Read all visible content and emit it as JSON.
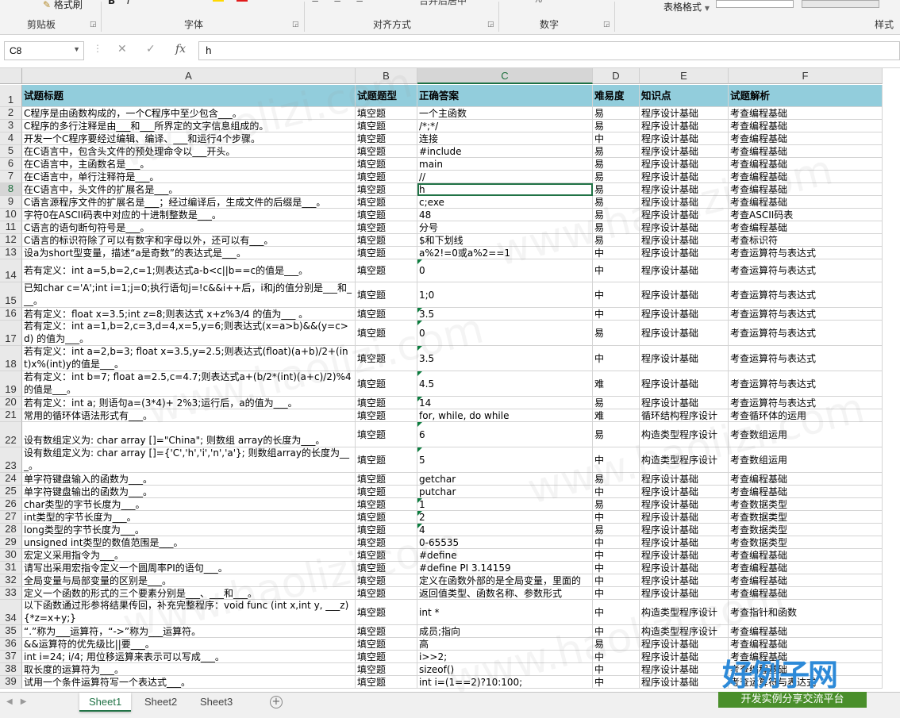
{
  "ribbon": {
    "format_painter": "格式刷",
    "clipboard_label": "剪贴板",
    "font_label": "字体",
    "align_label": "对齐方式",
    "merge_label": "合并后居中",
    "number_label": "数字",
    "number_percent": "%",
    "table_format": "表格格式",
    "styles_label": "样式"
  },
  "formula_bar": {
    "cell_ref": "C8",
    "fx_label": "fx",
    "value": "h"
  },
  "columns": [
    "A",
    "B",
    "C",
    "D",
    "E",
    "F"
  ],
  "selected_column": "C",
  "selected_row": "8",
  "rows": [
    {
      "n": "1",
      "h": 28,
      "a": "试题标题",
      "b": "试题题型",
      "c": "正确答案",
      "d": "难易度",
      "e": "知识点",
      "f": "试题解析",
      "hdr": true
    },
    {
      "n": "2",
      "h": 16,
      "a": "C程序是由函数构成的，一个C程序中至少包含___。",
      "b": "填空题",
      "c": "一个主函数",
      "d": "易",
      "e": "程序设计基础",
      "f": "考查编程基础"
    },
    {
      "n": "3",
      "h": 16,
      "a": "C程序的多行注释是由___和___所界定的文字信息组成的。",
      "b": "填空题",
      "c": "/*;*/",
      "d": "易",
      "e": "程序设计基础",
      "f": "考查编程基础"
    },
    {
      "n": "4",
      "h": 16,
      "a": "开发一个C程序要经过编辑、编译、___和运行4个步骤。",
      "b": "填空题",
      "c": "连接",
      "d": "中",
      "e": "程序设计基础",
      "f": "考查编程基础"
    },
    {
      "n": "5",
      "h": 16,
      "a": "在C语言中，包含头文件的预处理命令以___开头。",
      "b": "填空题",
      "c": "#include",
      "d": "易",
      "e": "程序设计基础",
      "f": "考查编程基础"
    },
    {
      "n": "6",
      "h": 16,
      "a": "在C语言中，主函数名是___。",
      "b": "填空题",
      "c": "main",
      "d": "易",
      "e": "程序设计基础",
      "f": "考查编程基础"
    },
    {
      "n": "7",
      "h": 16,
      "a": "在C语言中，单行注释符是___。",
      "b": "填空题",
      "c": "//",
      "d": "易",
      "e": "程序设计基础",
      "f": "考查编程基础"
    },
    {
      "n": "8",
      "h": 16,
      "a": "在C语言中，头文件的扩展名是___。",
      "b": "填空题",
      "c": "h",
      "d": "易",
      "e": "程序设计基础",
      "f": "考查编程基础",
      "active": true
    },
    {
      "n": "9",
      "h": 16,
      "a": "C语言源程序文件的扩展名是___；经过编译后，生成文件的后缀是___。",
      "b": "填空题",
      "c": "c;exe",
      "d": "易",
      "e": "程序设计基础",
      "f": "考查编程基础"
    },
    {
      "n": "10",
      "h": 16,
      "a": "字符0在ASCII码表中对应的十进制整数是___。",
      "b": "填空题",
      "c": "48",
      "d": "易",
      "e": "程序设计基础",
      "f": "考查ASCII码表"
    },
    {
      "n": "11",
      "h": 16,
      "a": "C语言的语句断句符号是___。",
      "b": "填空题",
      "c": "分号",
      "d": "易",
      "e": "程序设计基础",
      "f": "考查编程基础"
    },
    {
      "n": "12",
      "h": 16,
      "a": "C语言的标识符除了可以有数字和字母以外，还可以有___。",
      "b": "填空题",
      "c": "$和下划线",
      "d": "易",
      "e": "程序设计基础",
      "f": "考查标识符"
    },
    {
      "n": "13",
      "h": 16,
      "a": "设a为short型变量，描述“a是奇数”的表达式是___。",
      "b": "填空题",
      "c": "a%2!=0或a%2==1",
      "d": "中",
      "e": "程序设计基础",
      "f": "考查运算符与表达式"
    },
    {
      "n": "14",
      "h": 29,
      "a": "若有定义：int a=5,b=2,c=1;则表达式a-b<c||b==c的值是___。",
      "b": "填空题",
      "c": "0",
      "d": "中",
      "e": "程序设计基础",
      "f": "考查运算符与表达式",
      "tri": true
    },
    {
      "n": "15",
      "h": 32,
      "a": "已知char c='A';int i=1;j=0;执行语句j=!c&&i++后，i和j的值分别是___和___。",
      "b": "填空题",
      "c": "1;0",
      "d": "中",
      "e": "程序设计基础",
      "f": "考查运算符与表达式",
      "wrap": true
    },
    {
      "n": "16",
      "h": 16,
      "a": "若有定义：float x=3.5;int z=8;则表达式 x+z%3/4 的值为___ 。",
      "b": "填空题",
      "c": "3.5",
      "d": "中",
      "e": "程序设计基础",
      "f": "考查运算符与表达式",
      "tri": true
    },
    {
      "n": "17",
      "h": 32,
      "a": "若有定义：int a=1,b=2,c=3,d=4,x=5,y=6;则表达式(x=a>b)&&(y=c>d) 的值为___。",
      "b": "填空题",
      "c": "0",
      "d": "易",
      "e": "程序设计基础",
      "f": "考查运算符与表达式",
      "wrap": true,
      "tri": true
    },
    {
      "n": "18",
      "h": 32,
      "a": "若有定义：int a=2,b=3; float x=3.5,y=2.5;则表达式(float)(a+b)/2+(int)x%(int)y的值是___。",
      "b": "填空题",
      "c": "3.5",
      "d": "中",
      "e": "程序设计基础",
      "f": "考查运算符与表达式",
      "wrap": true,
      "tri": true
    },
    {
      "n": "19",
      "h": 32,
      "a": "若有定义：int b=7; float a=2.5,c=4.7;则表达式a+(b/2*(int)(a+c)/2)%4的值是___。",
      "b": "填空题",
      "c": "4.5",
      "d": "难",
      "e": "程序设计基础",
      "f": "考查运算符与表达式",
      "wrap": true,
      "tri": true
    },
    {
      "n": "20",
      "h": 16,
      "a": "若有定义：int a; 则语句a=(3*4)+ 2%3;运行后，a的值为___。",
      "b": "填空题",
      "c": "14",
      "d": "易",
      "e": "程序设计基础",
      "f": "考查运算符与表达式",
      "tri": true
    },
    {
      "n": "21",
      "h": 16,
      "a": "常用的循环体语法形式有___。",
      "b": "填空题",
      "c": "for, while, do while",
      "d": "难",
      "e": "循环结构程序设计",
      "f": "考查循环体的运用"
    },
    {
      "n": "22",
      "h": 32,
      "a": "设有数组定义为: char array []=\"China\"; 则数组 array的长度为___。",
      "b": "填空题",
      "c": "6",
      "d": "易",
      "e": "构造类型程序设计",
      "f": "考查数组运用",
      "wrap": true,
      "tri": true
    },
    {
      "n": "23",
      "h": 32,
      "a": "设有数组定义为: char array []={'C','h','i','n','a'}; 则数组array的长度为___。",
      "b": "填空题",
      "c": "5",
      "d": "中",
      "e": "构造类型程序设计",
      "f": "考查数组运用",
      "wrap": true,
      "tri": true
    },
    {
      "n": "24",
      "h": 16,
      "a": "单字符键盘输入的函数为___。",
      "b": "填空题",
      "c": "getchar",
      "d": "易",
      "e": "程序设计基础",
      "f": "考查编程基础"
    },
    {
      "n": "25",
      "h": 16,
      "a": "单字符键盘输出的函数为___。",
      "b": "填空题",
      "c": "putchar",
      "d": "中",
      "e": "程序设计基础",
      "f": "考查编程基础"
    },
    {
      "n": "26",
      "h": 16,
      "a": "char类型的字节长度为___。",
      "b": "填空题",
      "c": "1",
      "d": "易",
      "e": "程序设计基础",
      "f": "考查数据类型",
      "tri": true
    },
    {
      "n": "27",
      "h": 16,
      "a": "int类型的字节长度为___。",
      "b": "填空题",
      "c": "2",
      "d": "中",
      "e": "程序设计基础",
      "f": "考查数据类型",
      "tri": true
    },
    {
      "n": "28",
      "h": 16,
      "a": "long类型的字节长度为___。",
      "b": "填空题",
      "c": "4",
      "d": "易",
      "e": "程序设计基础",
      "f": "考查数据类型",
      "tri": true
    },
    {
      "n": "29",
      "h": 16,
      "a": "unsigned int类型的数值范围是___。",
      "b": "填空题",
      "c": "0-65535",
      "d": "中",
      "e": "程序设计基础",
      "f": "考查数据类型"
    },
    {
      "n": "30",
      "h": 16,
      "a": "宏定义采用指令为___。",
      "b": "填空题",
      "c": "#define",
      "d": "中",
      "e": "程序设计基础",
      "f": "考查编程基础"
    },
    {
      "n": "31",
      "h": 16,
      "a": "请写出采用宏指令定义一个圆周率PI的语句___。",
      "b": "填空题",
      "c": "#define PI 3.14159",
      "d": "中",
      "e": "程序设计基础",
      "f": "考查编程基础"
    },
    {
      "n": "32",
      "h": 16,
      "a": "全局变量与局部变量的区别是___。",
      "b": "填空题",
      "c": "定义在函数外部的是全局变量，里面的",
      "d": "中",
      "e": "程序设计基础",
      "f": "考查编程基础"
    },
    {
      "n": "33",
      "h": 16,
      "a": "定义一个函数的形式的三个要素分别是___、___和___。",
      "b": "填空题",
      "c": "返回值类型、函数名称、参数形式",
      "d": "中",
      "e": "程序设计基础",
      "f": "考查编程基础"
    },
    {
      "n": "34",
      "h": 32,
      "a": "以下函数通过形参将结果传回，补充完整程序：void func (int x,int y, ___z){*z=x+y;}",
      "b": "填空题",
      "c": "int *",
      "d": "中",
      "e": "构造类型程序设计",
      "f": "考查指针和函数",
      "wrap": true
    },
    {
      "n": "35",
      "h": 16,
      "a": "“.”称为___运算符，“->”称为___运算符。",
      "b": "填空题",
      "c": "成员;指向",
      "d": "中",
      "e": "构造类型程序设计",
      "f": "考查编程基础"
    },
    {
      "n": "36",
      "h": 16,
      "a": "&&运算符的优先级比||要___。",
      "b": "填空题",
      "c": "高",
      "d": "易",
      "e": "程序设计基础",
      "f": "考查编程基础"
    },
    {
      "n": "37",
      "h": 16,
      "a": "int i=24; i/4; 用位移运算来表示可以写成___。",
      "b": "填空题",
      "c": "i>>2;",
      "d": "中",
      "e": "程序设计基础",
      "f": "考查编程基础"
    },
    {
      "n": "38",
      "h": 16,
      "a": "取长度的运算符为___。",
      "b": "填空题",
      "c": "sizeof()",
      "d": "中",
      "e": "程序设计基础",
      "f": "考查编程基础"
    },
    {
      "n": "39",
      "h": 16,
      "a": "试用一个条件运算符写一个表达式___。",
      "b": "填空题",
      "c": "int i=(1==2)?10:100;",
      "d": "中",
      "e": "程序设计基础",
      "f": "考查运算符与表达式"
    }
  ],
  "sheets": [
    "Sheet1",
    "Sheet2",
    "Sheet3"
  ],
  "active_sheet": "Sheet1",
  "watermark": {
    "url": "www.haolizi.com",
    "logo_big": "好例子网",
    "logo_sub": "开发实例分享交流平台"
  },
  "colors": {
    "header_fill": "#92cddc",
    "accent": "#217346"
  }
}
